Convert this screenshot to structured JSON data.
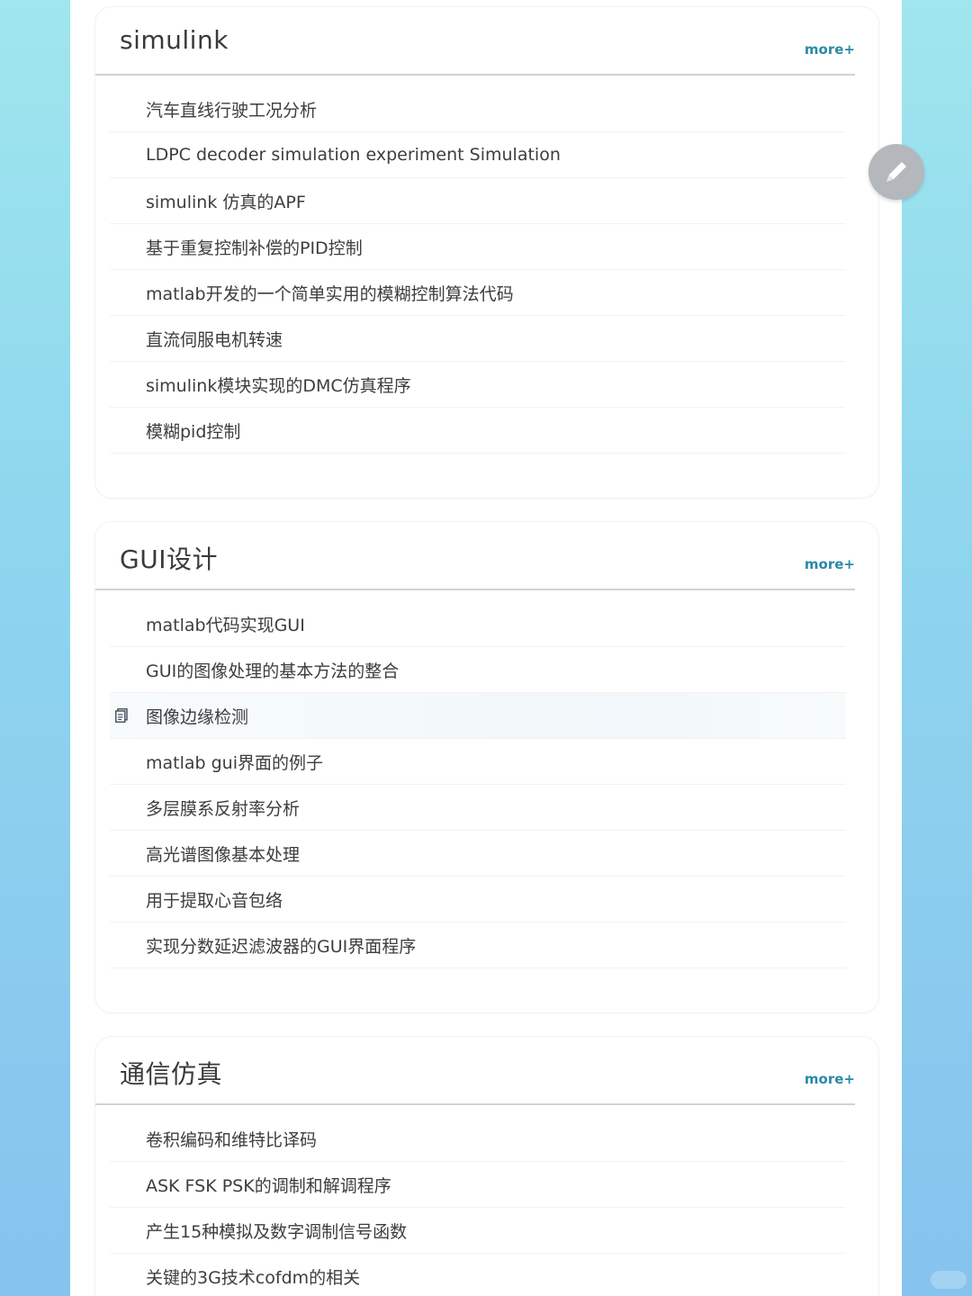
{
  "sections": [
    {
      "title": "simulink",
      "more_label": "more+",
      "items": [
        "汽车直线行驶工况分析",
        "LDPC decoder simulation experiment Simulation",
        "simulink 仿真的APF",
        "基于重复控制补偿的PID控制",
        "matlab开发的一个简单实用的模糊控制算法代码",
        "直流伺服电机转速",
        "simulink模块实现的DMC仿真程序",
        "模糊pid控制"
      ]
    },
    {
      "title": "GUI设计",
      "more_label": "more+",
      "items": [
        "matlab代码实现GUI",
        "GUI的图像处理的基本方法的整合",
        "图像边缘检测",
        "matlab gui界面的例子",
        "多层膜系反射率分析",
        "高光谱图像基本处理",
        "用于提取心音包络",
        "实现分数延迟滤波器的GUI界面程序"
      ]
    },
    {
      "title": "通信仿真",
      "more_label": "more+",
      "items": [
        "卷积编码和维特比译码",
        "ASK FSK PSK的调制和解调程序",
        "产生15种模拟及数字调制信号函数",
        "关键的3G技术cofdm的相关"
      ]
    }
  ],
  "icons": {
    "highlighted_item_icon": "document-icon",
    "floating_button_icon": "pencil-icon"
  },
  "colors": {
    "accent": "#2a8aa6",
    "background_gradient_top": "#9fe6ee",
    "background_gradient_bottom": "#86c3ee"
  }
}
